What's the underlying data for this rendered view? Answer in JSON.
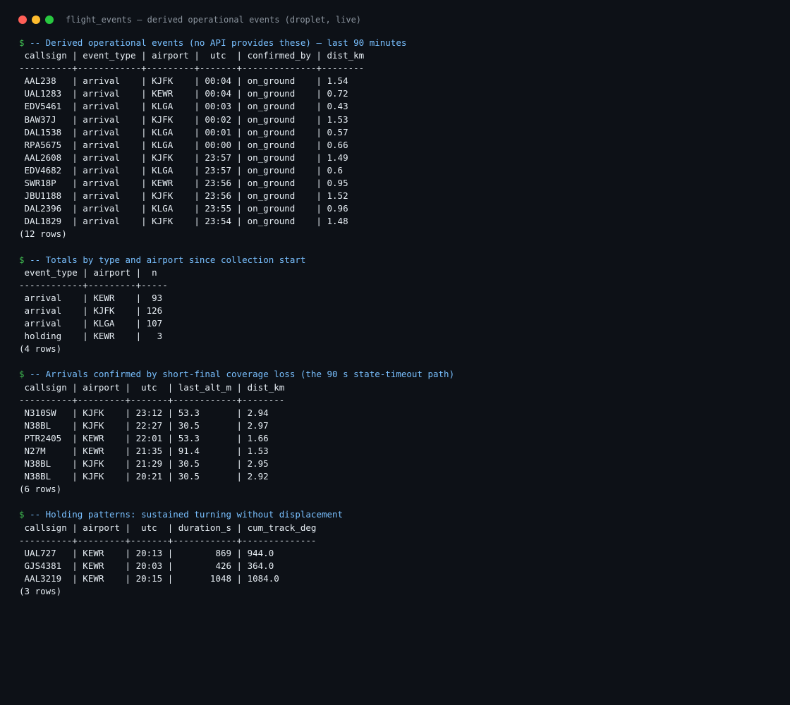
{
  "window": {
    "title": "flight_events — derived operational events (droplet, live)"
  },
  "prompt_symbol": "$",
  "queries": [
    {
      "comment": "-- Derived operational events (no API provides these) — last 90 minutes",
      "header": " callsign | event_type | airport |  utc  | confirmed_by | dist_km",
      "separator": "----------+------------+---------+-------+--------------+--------",
      "rows": [
        " AAL238   | arrival    | KJFK    | 00:04 | on_ground    | 1.54",
        " UAL1283  | arrival    | KEWR    | 00:04 | on_ground    | 0.72",
        " EDV5461  | arrival    | KLGA    | 00:03 | on_ground    | 0.43",
        " BAW37J   | arrival    | KJFK    | 00:02 | on_ground    | 1.53",
        " DAL1538  | arrival    | KLGA    | 00:01 | on_ground    | 0.57",
        " RPA5675  | arrival    | KLGA    | 00:00 | on_ground    | 0.66",
        " AAL2608  | arrival    | KJFK    | 23:57 | on_ground    | 1.49",
        " EDV4682  | arrival    | KLGA    | 23:57 | on_ground    | 0.6",
        " SWR18P   | arrival    | KEWR    | 23:56 | on_ground    | 0.95",
        " JBU1188  | arrival    | KJFK    | 23:56 | on_ground    | 1.52",
        " DAL2396  | arrival    | KLGA    | 23:55 | on_ground    | 0.96",
        " DAL1829  | arrival    | KJFK    | 23:54 | on_ground    | 1.48"
      ],
      "footer": "(12 rows)"
    },
    {
      "comment": "-- Totals by type and airport since collection start",
      "header": " event_type | airport |  n",
      "separator": "------------+---------+-----",
      "rows": [
        " arrival    | KEWR    |  93",
        " arrival    | KJFK    | 126",
        " arrival    | KLGA    | 107",
        " holding    | KEWR    |   3"
      ],
      "footer": "(4 rows)"
    },
    {
      "comment": "-- Arrivals confirmed by short-final coverage loss (the 90 s state-timeout path)",
      "header": " callsign | airport |  utc  | last_alt_m | dist_km",
      "separator": "----------+---------+-------+------------+--------",
      "rows": [
        " N310SW   | KJFK    | 23:12 | 53.3       | 2.94",
        " N38BL    | KJFK    | 22:27 | 30.5       | 2.97",
        " PTR2405  | KEWR    | 22:01 | 53.3       | 1.66",
        " N27M     | KEWR    | 21:35 | 91.4       | 1.53",
        " N38BL    | KJFK    | 21:29 | 30.5       | 2.95",
        " N38BL    | KJFK    | 20:21 | 30.5       | 2.92"
      ],
      "footer": "(6 rows)"
    },
    {
      "comment": "-- Holding patterns: sustained turning without displacement",
      "header": " callsign | airport |  utc  | duration_s | cum_track_deg",
      "separator": "----------+---------+-------+------------+--------------",
      "rows": [
        " UAL727   | KEWR    | 20:13 |        869 | 944.0",
        " GJS4381  | KEWR    | 20:03 |        426 | 364.0",
        " AAL3219  | KEWR    | 20:15 |       1048 | 1084.0"
      ],
      "footer": "(3 rows)"
    }
  ],
  "colors": {
    "background": "#0d1117",
    "prompt": "#3fb950",
    "comment": "#79c0ff",
    "text": "#e6edf3",
    "title": "#8b949e"
  }
}
